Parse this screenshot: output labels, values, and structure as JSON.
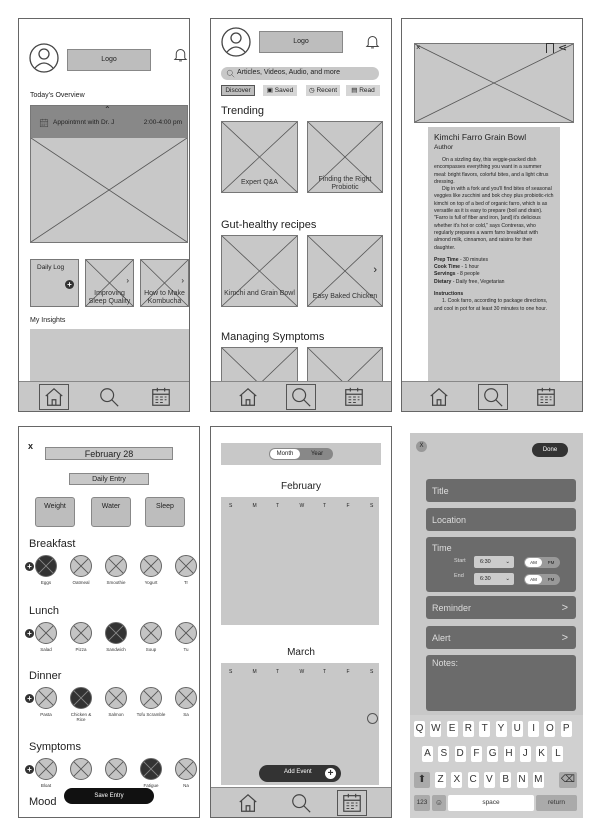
{
  "home": {
    "logo": "Logo",
    "overview": "Today's Overview",
    "appointment": "Appointmnt with Dr. J",
    "appt_time": "2:00-4:00 pm",
    "daily_log": "Daily Log",
    "cards": [
      "Improving Sleep Quality",
      "How to Make Kombucha"
    ],
    "insights": "My Insights"
  },
  "discover": {
    "logo": "Logo",
    "search_placeholder": "Articles, Videos, Audio, and more",
    "tabs": [
      "Discover",
      "Saved",
      "Recent",
      "Read"
    ],
    "trending": "Trending",
    "trending_items": [
      "Expert Q&A",
      "Finding the Right Probiotic"
    ],
    "gut": "Gut-healthy recipes",
    "gut_items": [
      "Kimchi and Grain Bowl",
      "Easy Baked Chicken"
    ],
    "symptoms": "Managing Symptoms"
  },
  "recipe": {
    "title": "Kimchi Farro Grain Bowl",
    "author": "Author",
    "p1": "On a sizzling day, this veggie-packed dish encompasses everything you want in a summer meal: bright flavors, colorful bites, and a light citrus dressing.",
    "p2": "Dig in with a fork and you'll find bites of seasonal veggies like zucchini and bok choy plus probiotic-rich kimchi on top of a bed of organic farro, which is as versatile as it is easy to prepare (boil and drain). \"Farro is full of fiber and iron, [and] it's delicious whether it's hot or cold,\" says Contreras, who regularly prepares a warm farro breakfast with almond milk, cinnamon, and raisins for their daughter.",
    "prep_label": "Prep Time",
    "prep": " - 30 minutes",
    "cook_label": "Cook Time",
    "cook": " - 1 hour",
    "serv_label": "Servings",
    "serv": " - 8 people",
    "diet_label": "Dietary",
    "diet": " - Daily free, Vegetarian",
    "instr": "Instructions",
    "step1": "1. Cook farro, according to package directions, and cool in pot for at least 30 minutes to one hour."
  },
  "entry": {
    "close": "x",
    "date": "February 28",
    "daily_entry": "Daily Entry",
    "metrics": [
      "Weight",
      "Water",
      "Sleep"
    ],
    "breakfast": "Breakfast",
    "breakfast_items": [
      "Eggs",
      "Oatmeal",
      "Smoothie",
      "Yogurt",
      "Tr"
    ],
    "lunch": "Lunch",
    "lunch_items": [
      "Salad",
      "Pizza",
      "Sandwich",
      "Soup",
      "Tu"
    ],
    "dinner": "Dinner",
    "dinner_items": [
      "Pasta",
      "Chicken & Rice",
      "Salmon",
      "Tofu Scramble",
      "Sa"
    ],
    "symptoms": "Symptoms",
    "symptom_items": [
      "Bloat",
      "",
      "",
      "Fatigue",
      "Na"
    ],
    "mood": "Mood",
    "save": "Save Entry"
  },
  "calendar": {
    "toggle": [
      "Month",
      "Year"
    ],
    "feb": "February",
    "mar": "March",
    "days": [
      "S",
      "M",
      "T",
      "W",
      "T",
      "F",
      "S"
    ],
    "add": "Add Event"
  },
  "event": {
    "close": "X",
    "done": "Done",
    "title": "Title",
    "location": "Location",
    "time": "Time",
    "start": "Start",
    "end": "End",
    "start_val": "6:30",
    "end_val": "6:30",
    "am": "AM",
    "pm": "PM",
    "reminder": "Reminder",
    "alert": "Alert",
    "notes": "Notes:",
    "chev": ">",
    "row1": [
      "Q",
      "W",
      "E",
      "R",
      "T",
      "Y",
      "U",
      "I",
      "O",
      "P"
    ],
    "row2": [
      "A",
      "S",
      "D",
      "F",
      "G",
      "H",
      "J",
      "K",
      "L"
    ],
    "row3": [
      "Z",
      "X",
      "C",
      "V",
      "B",
      "N",
      "M"
    ],
    "k123": "123",
    "space": "space",
    "return": "return"
  }
}
